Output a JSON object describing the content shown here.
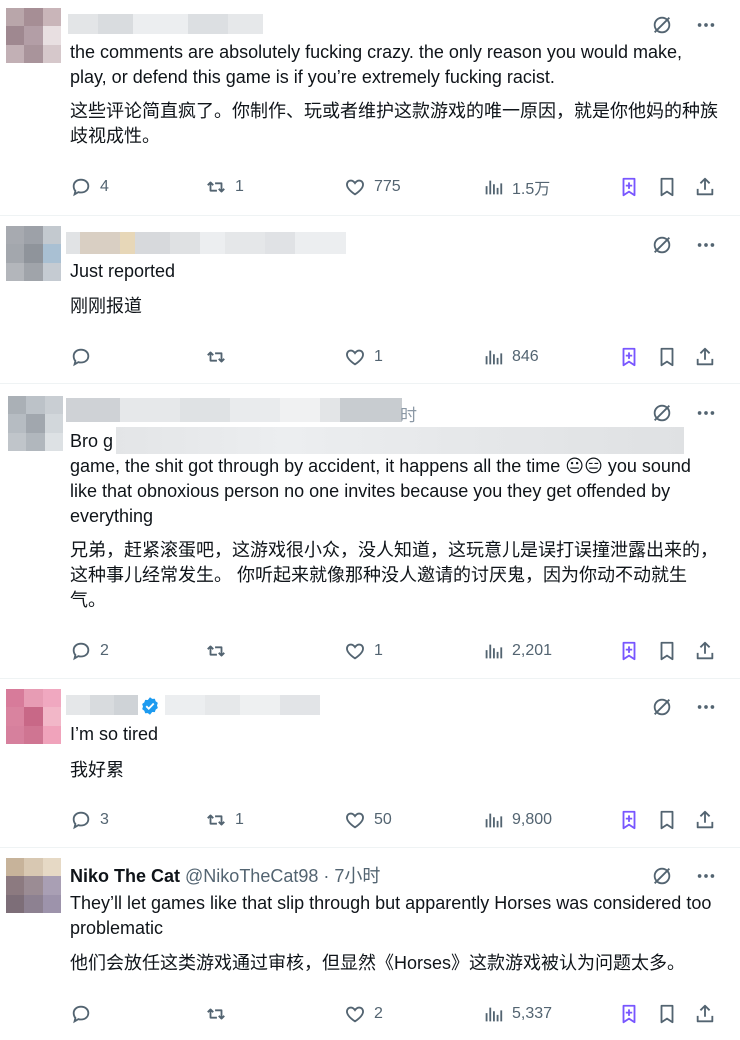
{
  "tweets": [
    {
      "text": "the comments are absolutely fucking crazy. the only reason you would make, play, or defend this game is if you’re extremely fucking racist.",
      "translation": "这些评论简直疯了。你制作、玩或者维护这款游戏的唯一原因，就是你他妈的种族歧视成性。",
      "replies": "4",
      "reposts": "1",
      "likes": "775",
      "views": "1.5万"
    },
    {
      "text": "Just reported",
      "translation": "刚刚报道",
      "replies": "",
      "reposts": "",
      "likes": "1",
      "views": "846"
    },
    {
      "time_suffix": "时",
      "text_start": "Bro g",
      "text": "game, the shit got through by accident, it happens all the time 😐😑 you sound like that obnoxious person no one invites because you they get offended by everything",
      "translation": "兄弟，赶紧滚蛋吧，这游戏很小众，没人知道，这玩意儿是误打误撞泄露出来的，这种事儿经常发生。 你听起来就像那种没人邀请的讨厌鬼，因为你动不动就生气。",
      "replies": "2",
      "reposts": "",
      "likes": "1",
      "views": "2,201"
    },
    {
      "text": "I’m so tired",
      "translation": "我好累",
      "replies": "3",
      "reposts": "1",
      "likes": "50",
      "views": "9,800"
    },
    {
      "name": "Niko The Cat",
      "handle": "@NikoTheCat98",
      "time": "· 7小时",
      "text": "They’ll let games like that slip through but apparently Horses was considered too problematic",
      "translation": "他们会放任这类游戏通过审核，但显然《Horses》这款游戏被认为问题太多。",
      "replies": "",
      "reposts": "",
      "likes": "2",
      "views": "5,337"
    }
  ],
  "icons": {
    "grok": "grok-icon",
    "more": "more-icon",
    "reply": "reply-icon",
    "repost": "repost-icon",
    "like": "like-icon",
    "views": "views-icon",
    "bookmark_ext": "bookmark-extension-icon",
    "bookmark": "bookmark-icon",
    "share": "share-icon",
    "verified": "verified-icon"
  },
  "colors": {
    "text": "#0f1419",
    "muted": "#536471",
    "accent": "#7856ff",
    "verified": "#1d9bf0"
  }
}
